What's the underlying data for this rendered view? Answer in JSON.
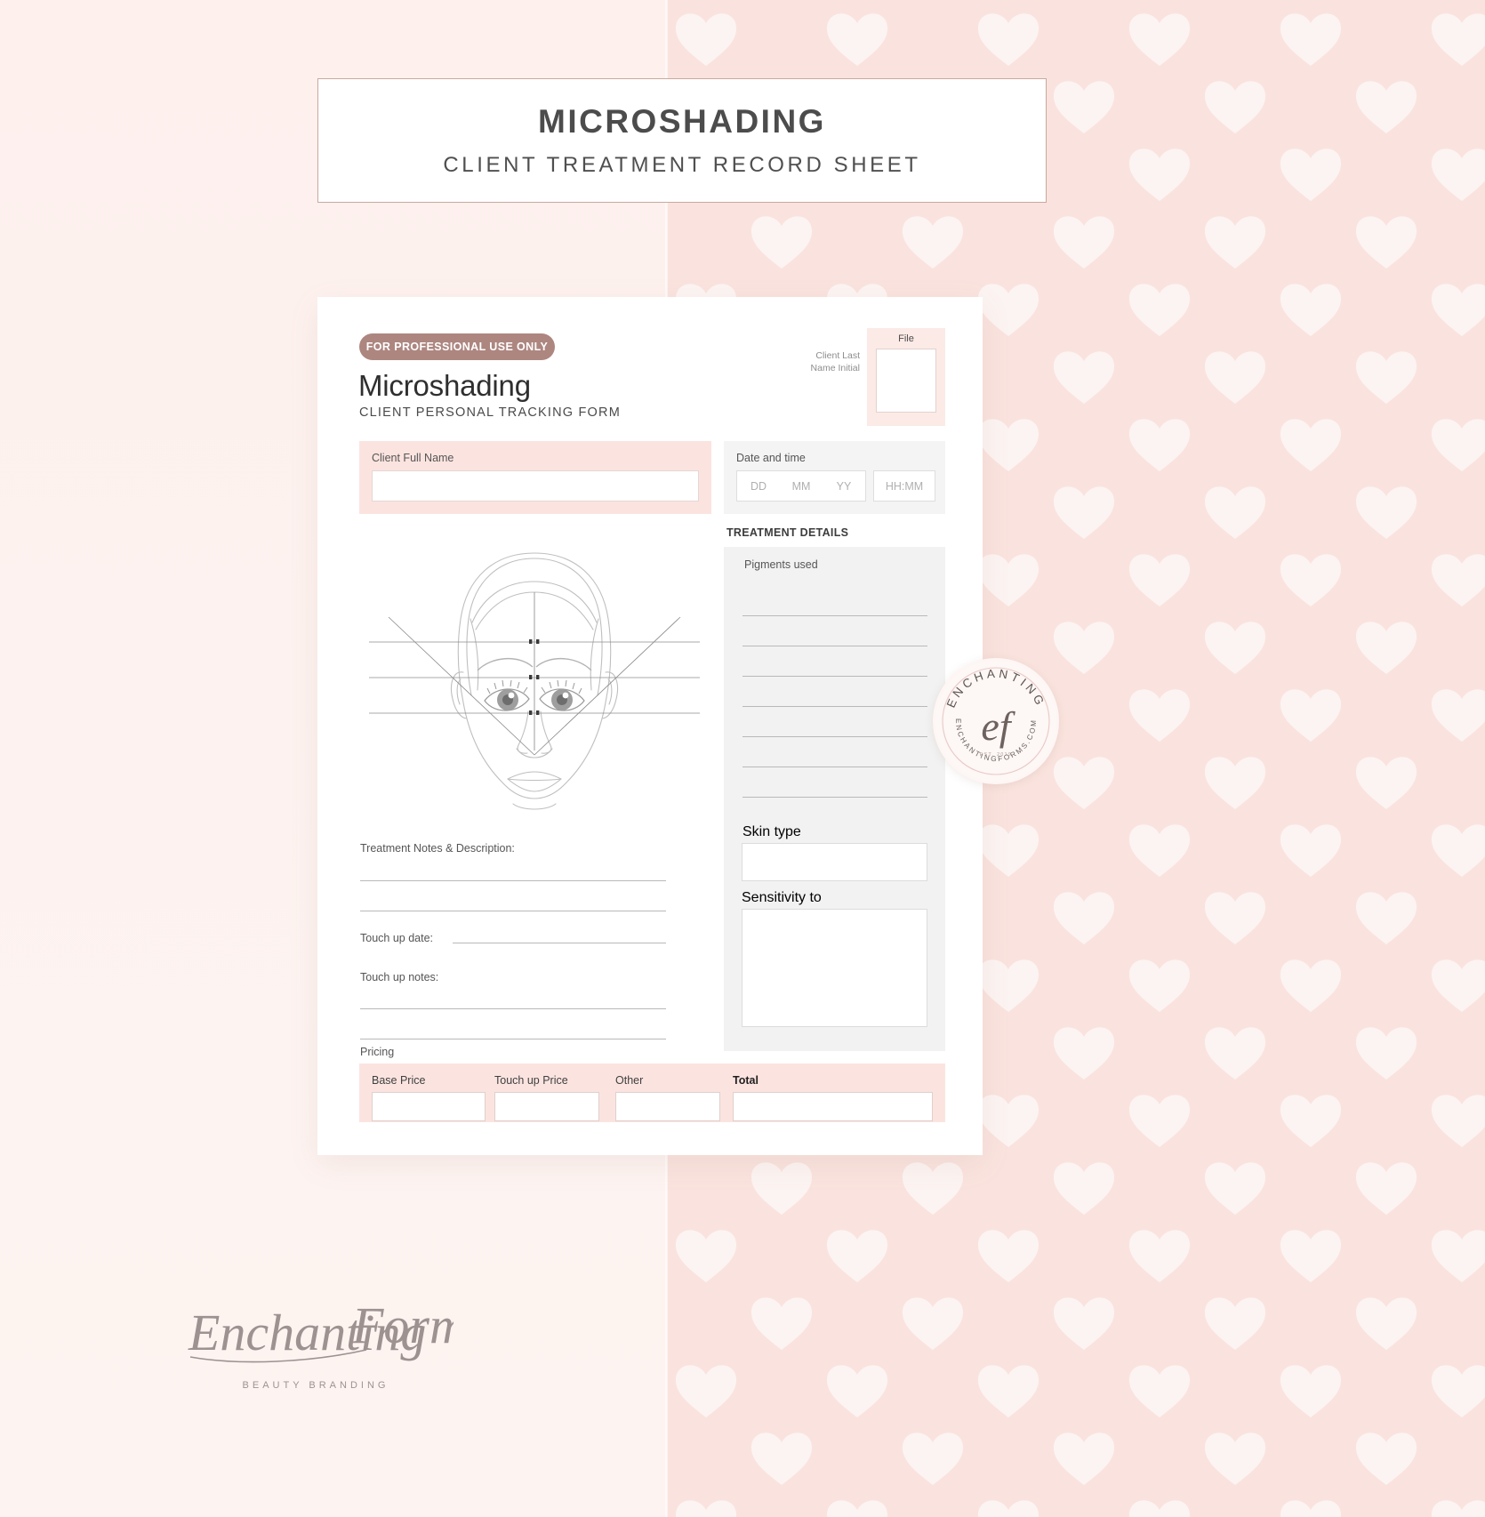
{
  "header": {
    "title": "MICROSHADING",
    "subtitle": "CLIENT TREATMENT RECORD SHEET"
  },
  "form": {
    "badge": "FOR PROFESSIONAL USE ONLY",
    "title": "Microshading",
    "subtitle": "CLIENT PERSONAL TRACKING FORM",
    "file_label": "File",
    "initial_label": "Client Last\nName Initial",
    "client_name": {
      "label": "Client Full Name",
      "value": ""
    },
    "date_time": {
      "label": "Date and time",
      "day_placeholder": "DD",
      "month_placeholder": "MM",
      "year_placeholder": "YY",
      "time_placeholder": "HH:MM",
      "day_value": "",
      "month_value": "",
      "year_value": "",
      "time_value": ""
    },
    "treatment_details_heading": "TREATMENT DETAILS",
    "pigments": {
      "label": "Pigments used",
      "line_count": 8,
      "values": [
        "",
        "",
        "",
        "",
        "",
        "",
        "",
        ""
      ]
    },
    "skin_type": {
      "label": "Skin type",
      "value": ""
    },
    "sensitivity": {
      "label": "Sensitivity to",
      "value": ""
    },
    "notes": {
      "label": "Treatment Notes & Description:",
      "line_count": 2,
      "values": [
        "",
        ""
      ]
    },
    "touch_up_date": {
      "label": "Touch up date:",
      "value": ""
    },
    "touch_up_notes": {
      "label": "Touch up notes:",
      "line_count": 2,
      "values": [
        "",
        ""
      ]
    },
    "pricing": {
      "label": "Pricing",
      "fields": [
        {
          "label": "Base Price",
          "value": ""
        },
        {
          "label": "Touch up Price",
          "value": ""
        },
        {
          "label": "Other",
          "value": ""
        },
        {
          "label": "Total",
          "value": ""
        }
      ]
    }
  },
  "stamp": {
    "top_text": "ENCHANTING",
    "monogram": "ef",
    "bottom_text": "ENCHANTINGFORMS.COM",
    "center_small": "EST. 2019"
  },
  "footer": {
    "brand": "Enchanting Forms",
    "tagline": "BEAUTY BRANDING"
  },
  "colors": {
    "page_bg_left": "#fdf1ee",
    "page_bg_right": "#fae3de",
    "accent_pill": "#ad8680",
    "panel_pink": "#fbe4e0",
    "panel_grey": "#f2f2f2",
    "title_border": "#c9a99e",
    "text_dark": "#2f2f2f",
    "text_muted": "#8d8d8d"
  }
}
